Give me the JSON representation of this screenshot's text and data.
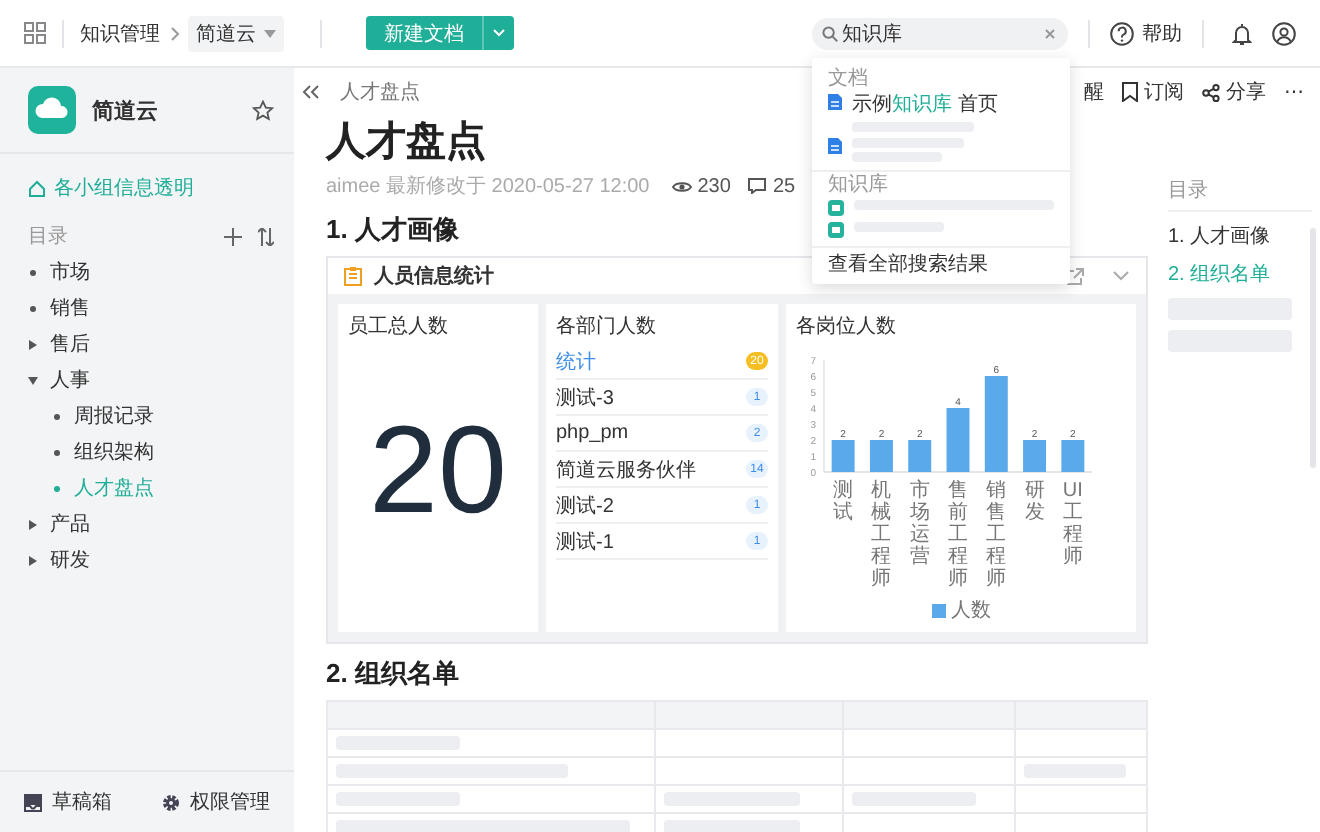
{
  "topbar": {
    "section": "知识管理",
    "space": "简道云",
    "new_button": "新建文档",
    "search": {
      "value": "知识库"
    },
    "help": "帮助"
  },
  "sidebar": {
    "space_name": "简道云",
    "starred": false,
    "pinned_link": "各小组信息透明",
    "toc_label": "目录",
    "tree": [
      {
        "kind": "leaf",
        "label": "市场",
        "selected": false
      },
      {
        "kind": "leaf",
        "label": "销售",
        "selected": false
      },
      {
        "kind": "branch",
        "label": "售后",
        "expanded": false,
        "selected": false
      },
      {
        "kind": "branch",
        "label": "人事",
        "expanded": true,
        "selected": false,
        "children": [
          {
            "kind": "leaf",
            "label": "周报记录",
            "selected": false
          },
          {
            "kind": "leaf",
            "label": "组织架构",
            "selected": false
          },
          {
            "kind": "leaf",
            "label": "人才盘点",
            "selected": true
          }
        ]
      },
      {
        "kind": "branch",
        "label": "产品",
        "expanded": false,
        "selected": false
      },
      {
        "kind": "branch",
        "label": "研发",
        "expanded": false,
        "selected": false
      }
    ],
    "footer": [
      {
        "kind": "drafts",
        "label": "草稿箱"
      },
      {
        "kind": "permissions",
        "label": "权限管理"
      }
    ]
  },
  "document": {
    "breadcrumb": "人才盘点",
    "toolbar": [
      {
        "kind": "remind",
        "label": "醒"
      },
      {
        "kind": "subscribe",
        "label": "订阅"
      },
      {
        "kind": "share",
        "label": "分享"
      },
      {
        "kind": "more",
        "label": "⋯"
      }
    ],
    "title": "人才盘点",
    "meta": "aimee 最新修改于 2020-05-27 12:00",
    "views": "230",
    "comments": "25",
    "sections": [
      {
        "kind": "dashboard",
        "heading": "1. 人才画像",
        "card": {
          "title": "人员信息统计",
          "total": {
            "label": "员工总人数",
            "value": "20"
          },
          "departments": {
            "label": "各部门人数",
            "rows": [
              {
                "name": "统计",
                "count": "20",
                "selected": true
              },
              {
                "name": "测试-3",
                "count": "1",
                "selected": false
              },
              {
                "name": "php_pm",
                "count": "2",
                "selected": false
              },
              {
                "name": "简道云服务伙伴",
                "count": "14",
                "selected": false
              },
              {
                "name": "测试-2",
                "count": "1",
                "selected": false
              },
              {
                "name": "测试-1",
                "count": "1",
                "selected": false
              }
            ]
          },
          "positions": {
            "label": "各岗位人数",
            "chart_data": {
              "type": "bar",
              "categories": [
                "测试",
                "机械工程师",
                "市场运营",
                "售前工程师",
                "销售工程师",
                "研发",
                "UI工程师"
              ],
              "series": [
                {
                  "name": "人数",
                  "color": "#5aa9ea",
                  "values": [
                    2,
                    2,
                    2,
                    4,
                    6,
                    2,
                    2
                  ]
                }
              ],
              "ylim": [
                0,
                7
              ],
              "yticks": [
                0,
                1,
                2,
                3,
                4,
                5,
                6,
                7
              ],
              "data_labels": true
            }
          }
        }
      },
      {
        "kind": "table",
        "heading": "2. 组织名单"
      }
    ]
  },
  "outline": {
    "label": "目录",
    "items": [
      {
        "label": "1. 人才画像",
        "selected": false
      },
      {
        "label": "2. 组织名单",
        "selected": true
      }
    ]
  },
  "search_popup": {
    "sections": [
      {
        "title": "文档",
        "results": [
          {
            "kind": "doc",
            "prefix": "示例",
            "match": "知识库",
            "suffix": " 首页"
          },
          {
            "kind": "doc"
          }
        ]
      },
      {
        "title": "知识库",
        "results": [
          {
            "kind": "kb"
          },
          {
            "kind": "kb"
          }
        ]
      }
    ],
    "footer": "查看全部搜索结果"
  }
}
